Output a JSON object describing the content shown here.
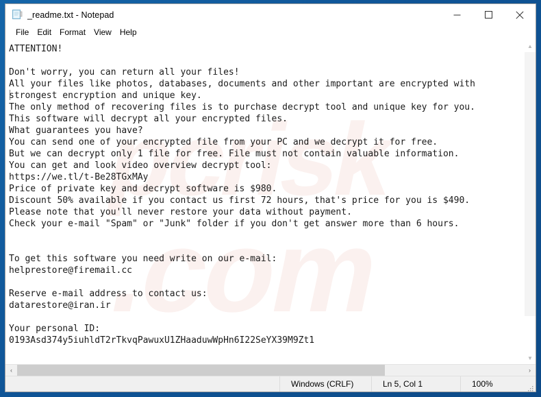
{
  "window": {
    "title": "_readme.txt - Notepad",
    "icon": "notepad-document-icon",
    "controls": {
      "minimize": "—",
      "maximize": "□",
      "close": "✕"
    }
  },
  "menu": {
    "items": [
      {
        "label": "File"
      },
      {
        "label": "Edit"
      },
      {
        "label": "Format"
      },
      {
        "label": "View"
      },
      {
        "label": "Help"
      }
    ]
  },
  "document": {
    "body": "ATTENTION!\n\nDon't worry, you can return all your files!\nAll your files like photos, databases, documents and other important are encrypted with\nstrongest encryption and unique key.\nThe only method of recovering files is to purchase decrypt tool and unique key for you.\nThis software will decrypt all your encrypted files.\nWhat guarantees you have?\nYou can send one of your encrypted file from your PC and we decrypt it for free.\nBut we can decrypt only 1 file for free. File must not contain valuable information.\nYou can get and look video overview decrypt tool:\nhttps://we.tl/t-Be28TGxMAy\nPrice of private key and decrypt software is $980.\nDiscount 50% available if you contact us first 72 hours, that's price for you is $490.\nPlease note that you'll never restore your data without payment.\nCheck your e-mail \"Spam\" or \"Junk\" folder if you don't get answer more than 6 hours.\n\n\nTo get this software you need write on our e-mail:\nhelprestore@firemail.cc\n\nReserve e-mail address to contact us:\ndatarestore@iran.ir\n\nYour personal ID:\n0193Asd374y5iuhldT2rTkvqPawuxU1ZHaaduwWpHn6I22SeYX39M9Zt1",
    "price_full": "$980",
    "price_discount": "$490",
    "discount_percent": "50%",
    "discount_window_hours": "72 hours",
    "response_time_hours": "6 hours",
    "video_url": "https://we.tl/t-Be28TGxMAy",
    "primary_email": "helprestore@firemail.cc",
    "reserve_email": "datarestore@iran.ir",
    "personal_id": "0193Asd374y5iuhldT2rTkvqPawuxU1ZHaaduwWpHn6I22SeYX39M9Zt1"
  },
  "scrollbars": {
    "vertical": {
      "up_arrow": "▲",
      "down_arrow": "▼"
    },
    "horizontal": {
      "left_arrow": "‹",
      "right_arrow": "›"
    }
  },
  "status_bar": {
    "encoding": "Windows (CRLF)",
    "position": "Ln 5, Col 1",
    "zoom": "100%"
  },
  "colors": {
    "desktop": "#0f5496",
    "window_bg": "#ffffff",
    "status_bg": "#f0f0f0",
    "text": "#1a1a1a",
    "scroll_thumb": "#cdcdcd"
  }
}
